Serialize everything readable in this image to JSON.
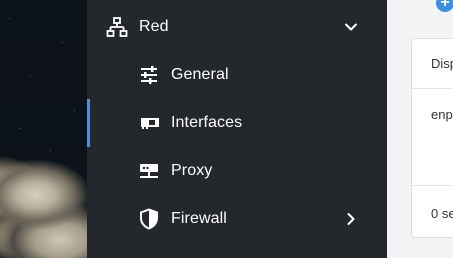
{
  "sidebar": {
    "section": {
      "label": "Red",
      "icon": "network-icon",
      "expanded": true
    },
    "items": [
      {
        "label": "General",
        "icon": "sliders-icon"
      },
      {
        "label": "Interfaces",
        "icon": "network-card-icon",
        "active": true
      },
      {
        "label": "Proxy",
        "icon": "proxy-server-icon"
      },
      {
        "label": "Firewall",
        "icon": "shield-icon",
        "has_submenu": true
      }
    ]
  },
  "content": {
    "header_cell": "Disp",
    "row_cell": "enp",
    "footer_cell": "0 se"
  },
  "colors": {
    "sidebar_bg": "#24272c",
    "active_indicator": "#4a90d9",
    "add_button": "#3d8fe0"
  }
}
